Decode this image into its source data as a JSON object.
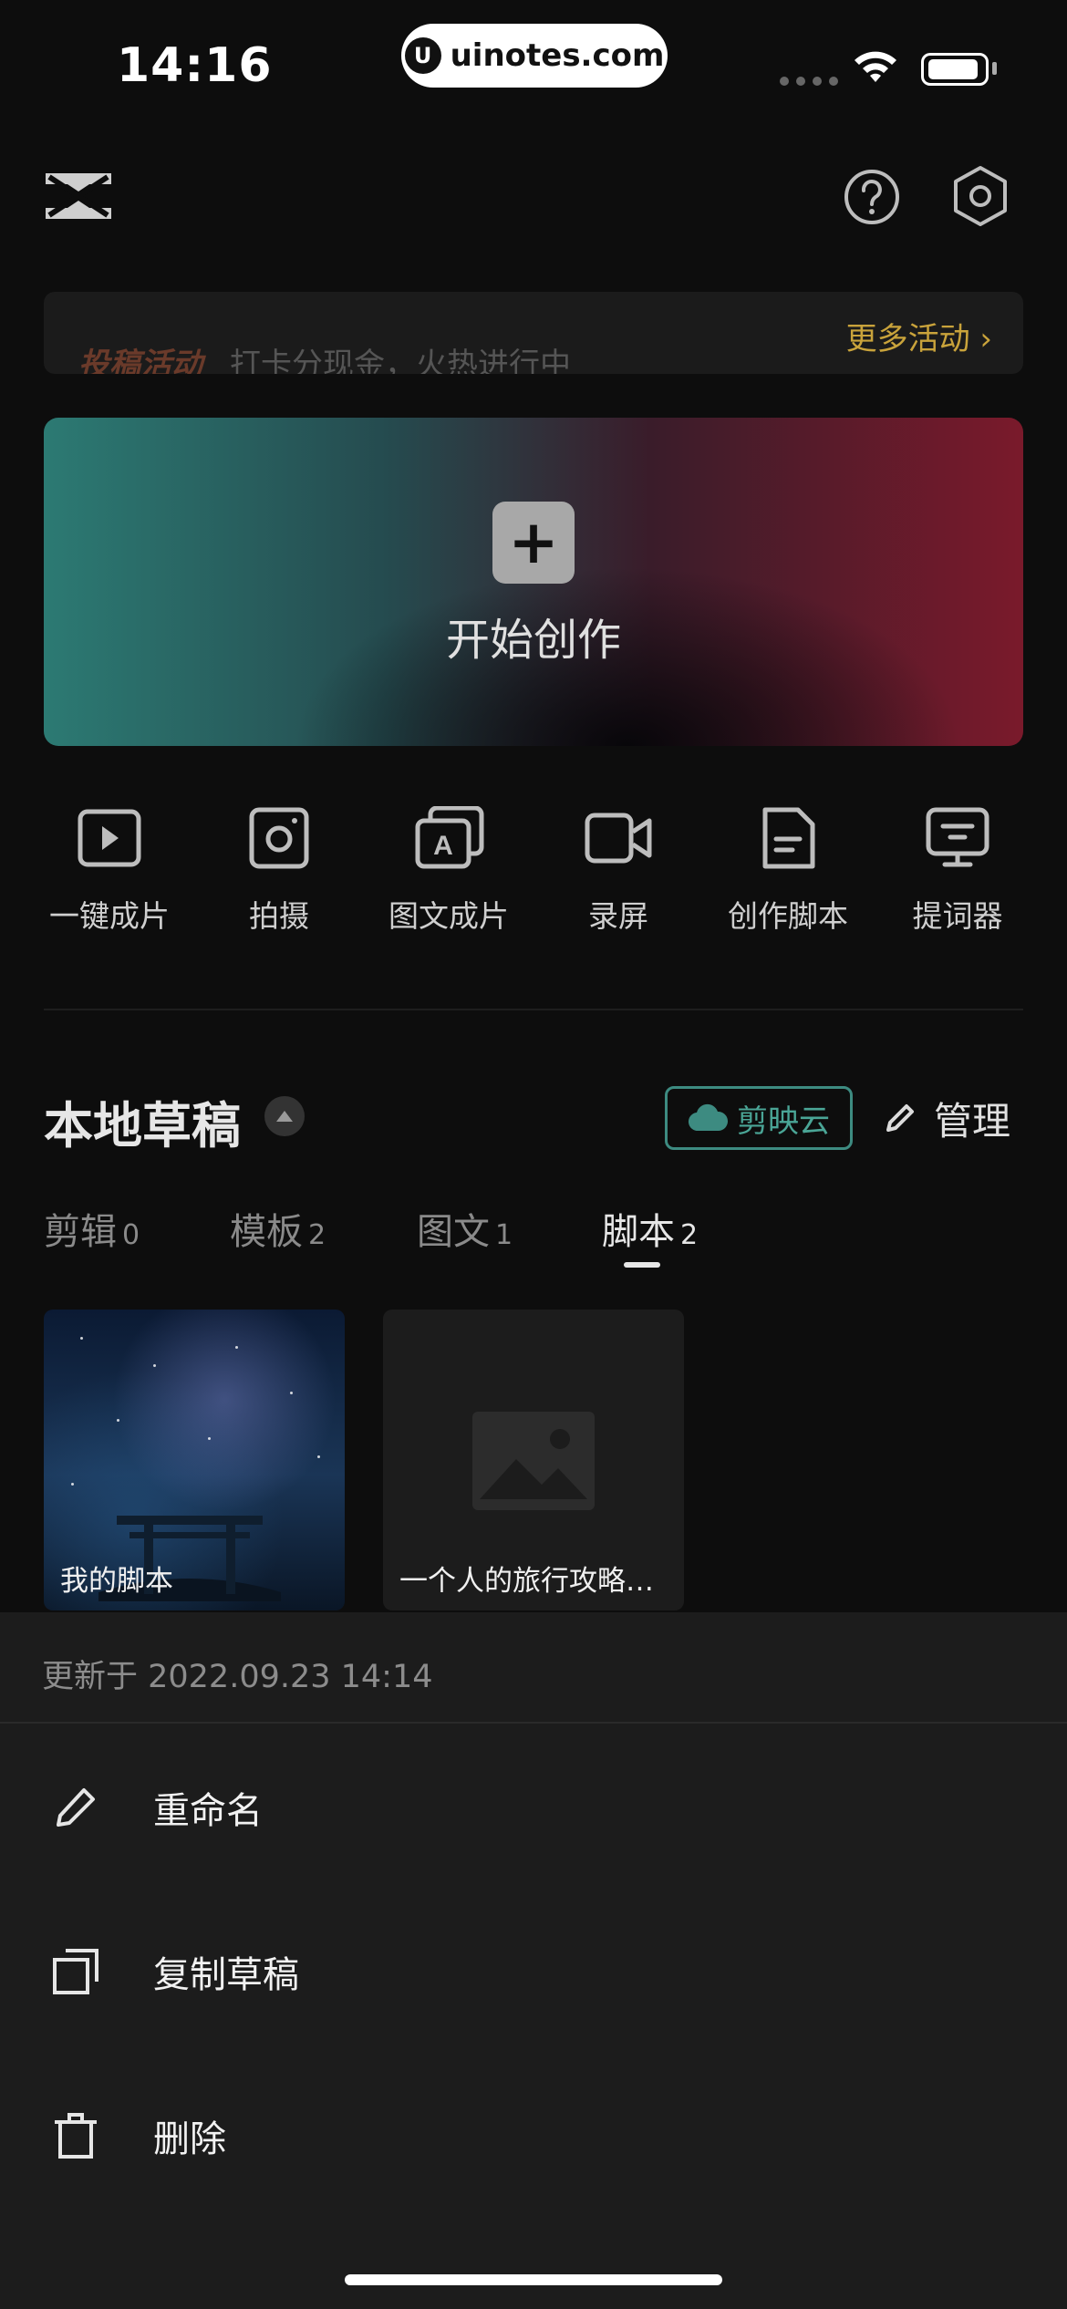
{
  "status_bar": {
    "time": "14:16",
    "watermark": "uinotes.com",
    "watermark_logo": "U"
  },
  "header": {
    "logo_icon": "capcut-logo-icon",
    "help_icon": "question-circle-icon",
    "settings_icon": "hexagon-gear-icon"
  },
  "banner": {
    "tag": "投稿活动",
    "text": "打卡分现金，火热进行中",
    "more_label": "更多活动",
    "more_chevron": "›",
    "accent": "#c9a33b"
  },
  "create": {
    "plus": "+",
    "label": "开始创作"
  },
  "tools": [
    {
      "label": "一键成片",
      "icon": "play-square-icon"
    },
    {
      "label": "拍摄",
      "icon": "camera-icon"
    },
    {
      "label": "图文成片",
      "icon": "text-image-icon"
    },
    {
      "label": "录屏",
      "icon": "video-camera-icon"
    },
    {
      "label": "创作脚本",
      "icon": "document-icon"
    },
    {
      "label": "提词器",
      "icon": "teleprompter-icon"
    }
  ],
  "drafts": {
    "title": "本地草稿",
    "cloud_label": "剪映云",
    "manage_label": "管理",
    "cloud_color": "#4aa596"
  },
  "tabs": [
    {
      "label": "剪辑",
      "count": "0"
    },
    {
      "label": "模板",
      "count": "2"
    },
    {
      "label": "图文",
      "count": "1"
    },
    {
      "label": "脚本",
      "count": "2",
      "active": true
    }
  ],
  "scripts": [
    {
      "title": "我的脚本"
    },
    {
      "title": "一个人的旅行攻略…"
    }
  ],
  "sheet": {
    "updated": "更新于 2022.09.23 14:14",
    "actions": [
      {
        "label": "重命名",
        "icon": "pencil-icon"
      },
      {
        "label": "复制草稿",
        "icon": "copy-icon"
      },
      {
        "label": "删除",
        "icon": "trash-icon"
      }
    ]
  }
}
